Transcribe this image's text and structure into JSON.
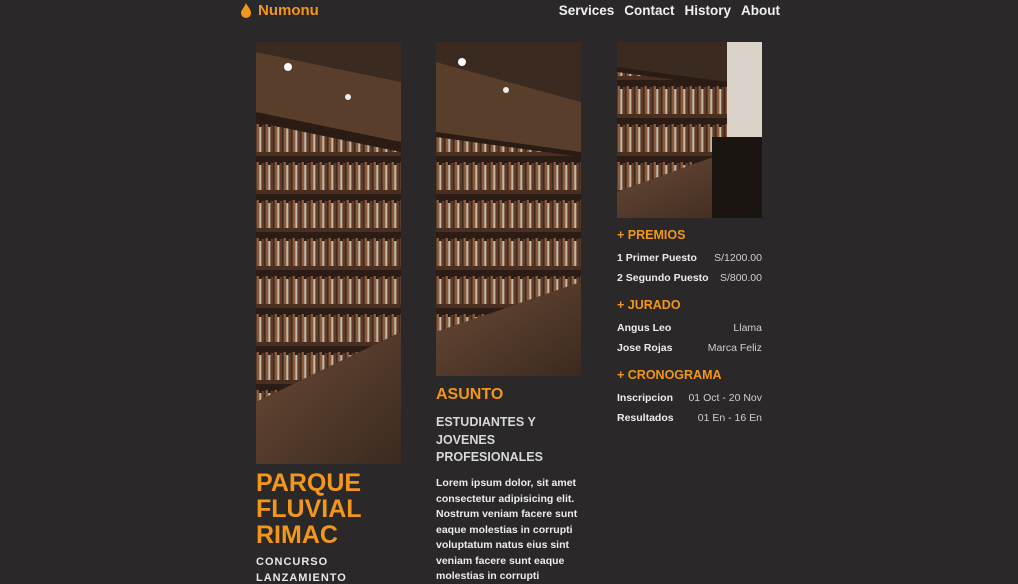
{
  "brand": {
    "name": "Numonu",
    "icon": "flame-icon",
    "accent": "#f3961c"
  },
  "nav": [
    "Services",
    "Contact",
    "History",
    "About"
  ],
  "project": {
    "title": "PARQUE FLUVIAL RIMAC",
    "subtitle": "CONCURSO LANZAMIENTO"
  },
  "asunto": {
    "heading": "ASUNTO",
    "subheading": "ESTUDIANTES Y JOVENES PROFESIONALES",
    "body": "Lorem ipsum dolor, sit amet consectetur adipisicing elit. Nostrum veniam facere sunt eaque molestias in corrupti voluptatum natus eius sint veniam facere sunt eaque molestias in corrupti"
  },
  "premios": {
    "heading": "+ PREMIOS",
    "rows": [
      {
        "k": "1 Primer Puesto",
        "v": "S/1200.00"
      },
      {
        "k": "2 Segundo Puesto",
        "v": "S/800.00"
      }
    ]
  },
  "jurado": {
    "heading": "+ JURADO",
    "rows": [
      {
        "k": "Angus Leo",
        "v": "Llama"
      },
      {
        "k": "Jose Rojas",
        "v": "Marca Feliz"
      }
    ]
  },
  "cronograma": {
    "heading": "+ CRONOGRAMA",
    "rows": [
      {
        "k": "Inscripcion",
        "v": "01 Oct - 20 Nov"
      },
      {
        "k": "Resultados",
        "v": "01 En - 16 En"
      }
    ]
  },
  "images": [
    "library-photo",
    "library-photo",
    "library-photo"
  ]
}
